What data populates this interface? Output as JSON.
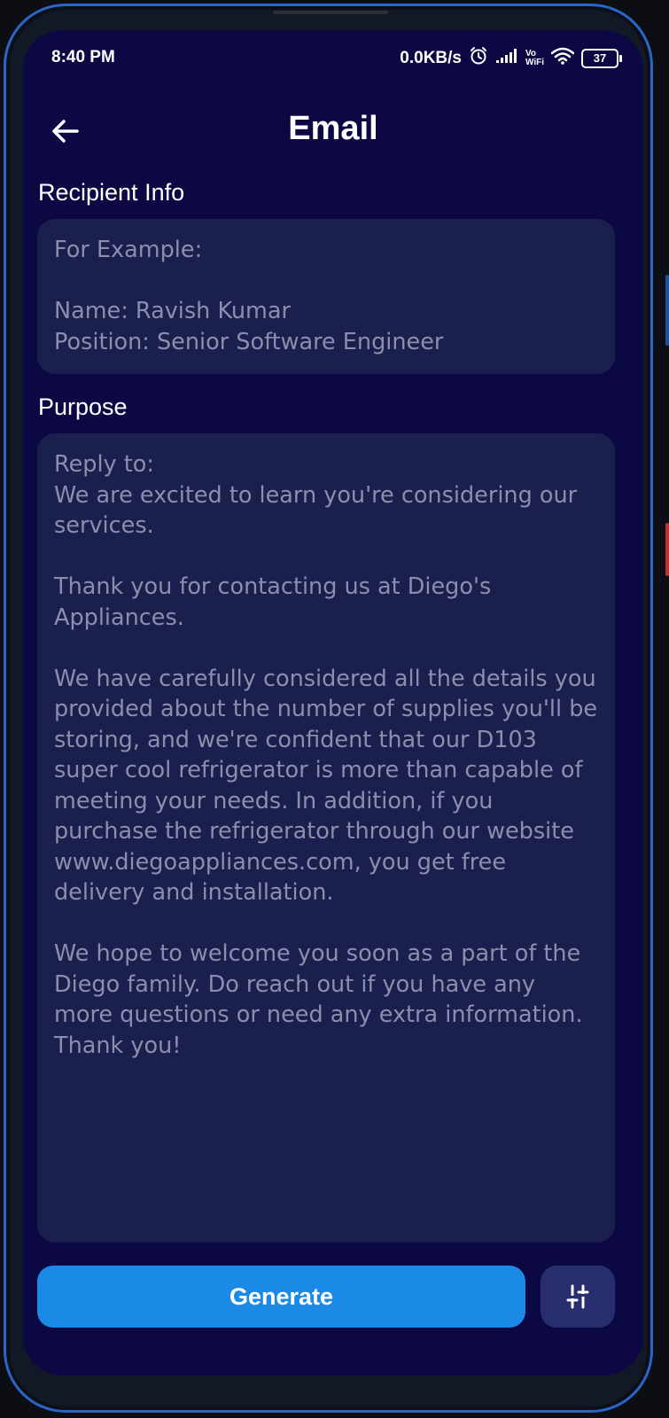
{
  "status_bar": {
    "time": "8:40 PM",
    "network_speed": "0.0KB/s",
    "vowifi_line1": "Vo",
    "vowifi_line2": "WiFi",
    "battery": "37",
    "icons": [
      "alarm-icon",
      "signal-icon",
      "vowifi-icon",
      "wifi-icon",
      "battery-icon"
    ]
  },
  "header": {
    "title": "Email",
    "back_icon": "arrow-left-icon"
  },
  "recipient": {
    "label": "Recipient Info",
    "placeholder": "For Example:\n\nName: Ravish Kumar\nPosition: Senior Software Engineer"
  },
  "purpose": {
    "label": "Purpose",
    "placeholder": "Reply to:\nWe are excited to learn you're considering our services.\n\nThank you for contacting us at Diego's Appliances.\n\nWe have carefully considered all the details you provided about the number of supplies you'll be storing, and we're confident that our D103 super cool refrigerator is more than capable of meeting your needs. In addition, if you purchase the refrigerator through our website www.diegoappliances.com, you get free delivery and installation.\n\nWe hope to welcome you soon as a part of the Diego family. Do reach out if you have any more questions or need any extra information.\nThank you!"
  },
  "actions": {
    "generate_label": "Generate",
    "settings_icon": "sliders-icon"
  },
  "colors": {
    "background": "#0b0843",
    "field": "#1a1f4e",
    "primary": "#1a8ae6",
    "secondary_button": "#262e6e",
    "placeholder_text": "#8a8fae"
  }
}
